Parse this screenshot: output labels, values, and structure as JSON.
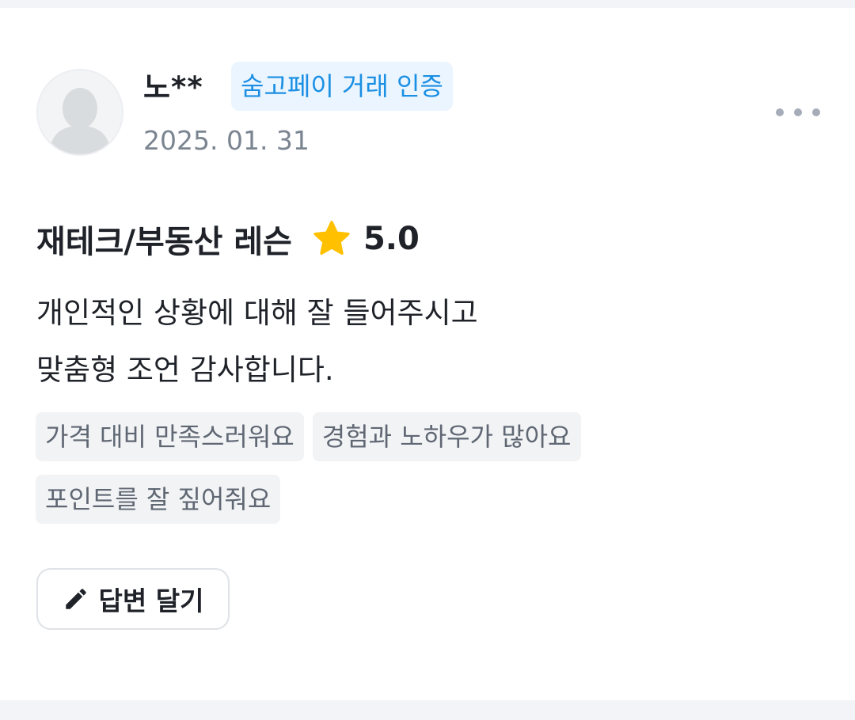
{
  "review": {
    "author_name": "노**",
    "badge_label": "숨고페이 거래 인증",
    "date": "2025. 01. 31",
    "service_title": "재테크/부동산 레슨",
    "rating": "5.0",
    "text_lines": [
      "개인적인 상황에 대해 잘 들어주시고",
      "맞춤형 조언 감사합니다."
    ],
    "tags": [
      "가격 대비 만족스러워요",
      "경험과 노하우가 많아요",
      "포인트를 잘 짚어줘요"
    ],
    "reply_button_label": "답변 달기"
  },
  "icons": {
    "avatar": "default-user-avatar",
    "more": "more-horizontal-icon",
    "star": "star-icon",
    "reply": "pencil-icon"
  },
  "colors": {
    "badge_text": "#1a8fe3",
    "badge_bg": "#eaf5ff",
    "star": "#ffc000",
    "tag_bg": "#f2f3f5",
    "muted_text": "#7b8591"
  }
}
